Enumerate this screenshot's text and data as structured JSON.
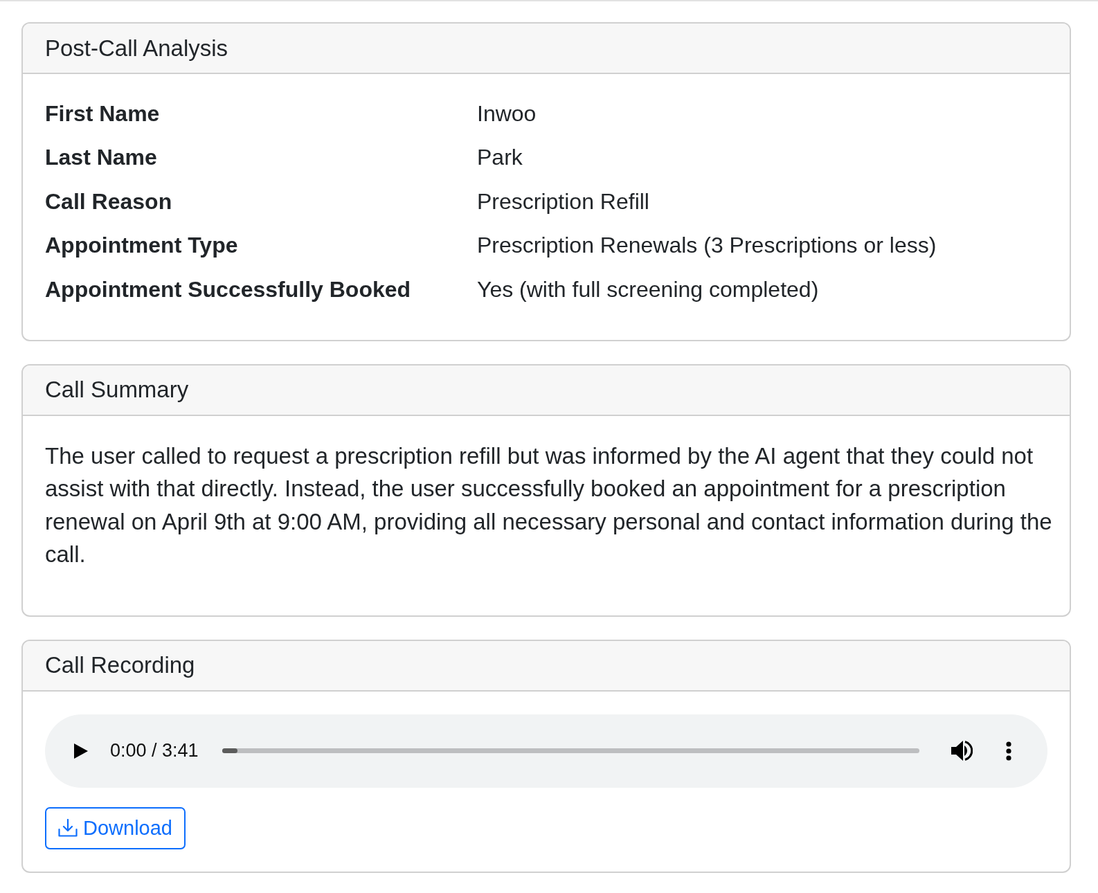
{
  "cards": [
    {
      "kind": "fields",
      "title": "Post-Call Analysis",
      "fields": [
        {
          "label": "First Name",
          "value": "Inwoo"
        },
        {
          "label": "Last Name",
          "value": "Park"
        },
        {
          "label": "Call Reason",
          "value": "Prescription Refill"
        },
        {
          "label": "Appointment Type",
          "value": "Prescription Renewals (3 Prescriptions or less)"
        },
        {
          "label": "Appointment Successfully Booked",
          "value": "Yes (with full screening completed)"
        }
      ]
    },
    {
      "kind": "text",
      "title": "Call Summary",
      "text": "The user called to request a prescription refill but was informed by the AI agent that they could not assist with that directly. Instead, the user successfully booked an appointment for a prescription renewal on April 9th at 9:00 AM, providing all necessary personal and contact information during the call."
    },
    {
      "kind": "audio",
      "title": "Call Recording",
      "player": {
        "time": "0:00 / 3:41",
        "level": 0
      },
      "download_button": "Download"
    }
  ]
}
